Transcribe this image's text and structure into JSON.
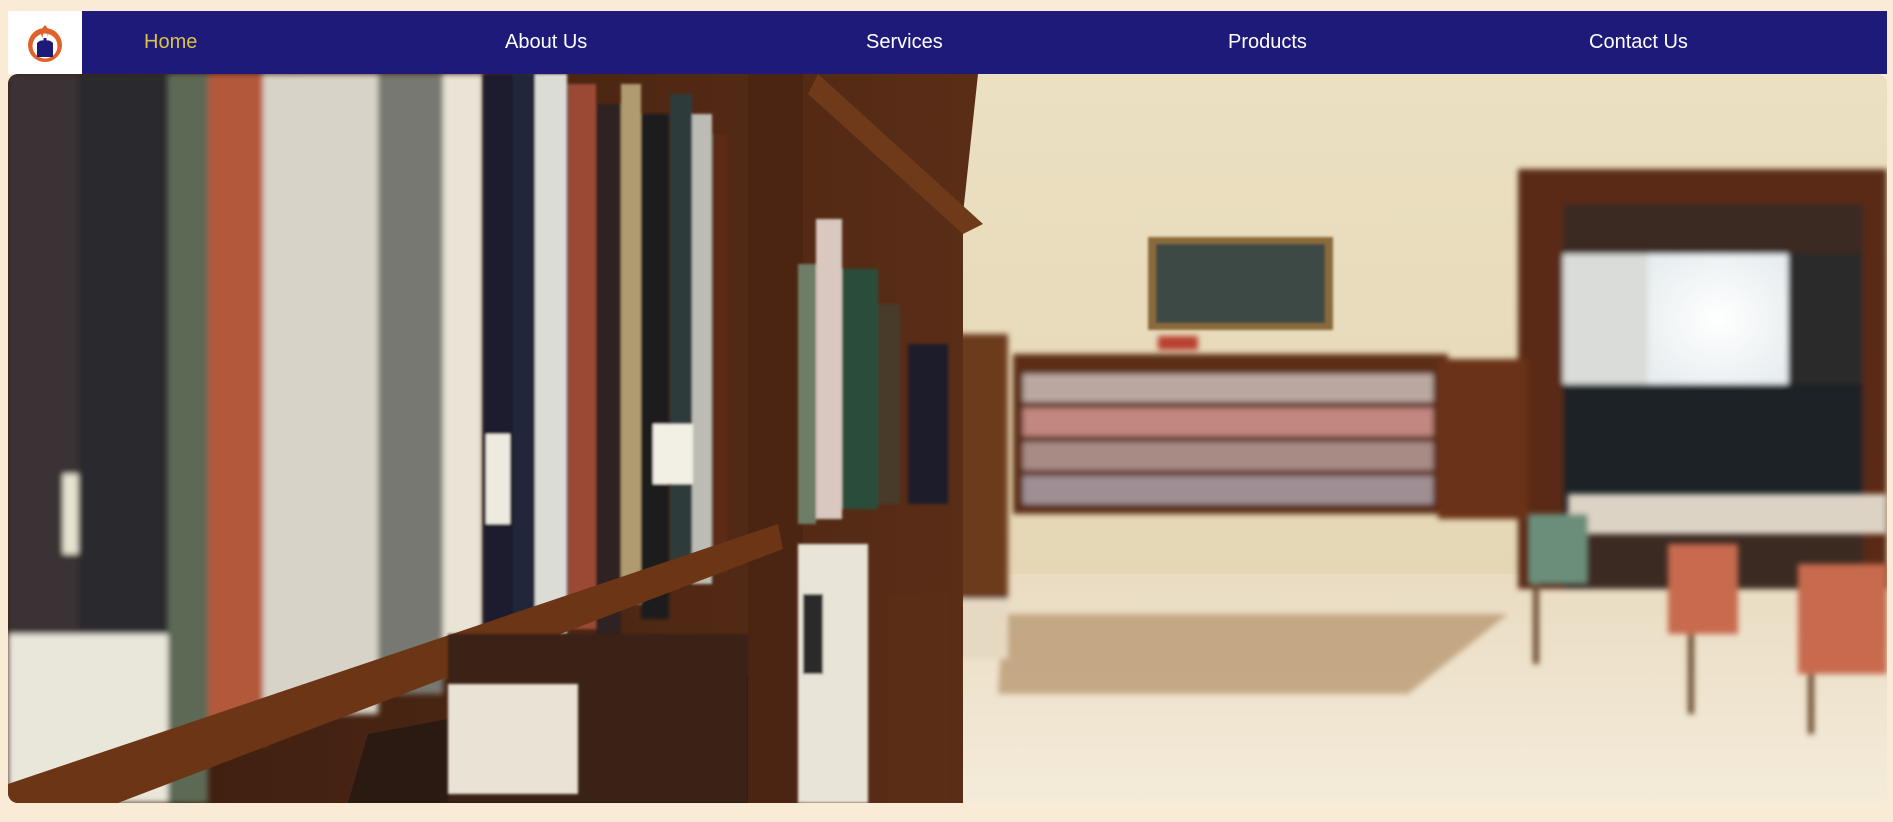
{
  "navbar": {
    "logo_icon": "flame-logo-icon",
    "items": [
      {
        "label": "Home",
        "active": true
      },
      {
        "label": "About Us",
        "active": false
      },
      {
        "label": "Services",
        "active": false
      },
      {
        "label": "Products",
        "active": false
      },
      {
        "label": "Contact Us",
        "active": false
      }
    ]
  },
  "hero": {
    "image_subject": "library-bookshelf-photo"
  },
  "colors": {
    "page_background": "#faebd7",
    "navbar_background": "#1e1a7a",
    "nav_text": "#ffffff",
    "nav_active_text": "#d8c24a"
  }
}
